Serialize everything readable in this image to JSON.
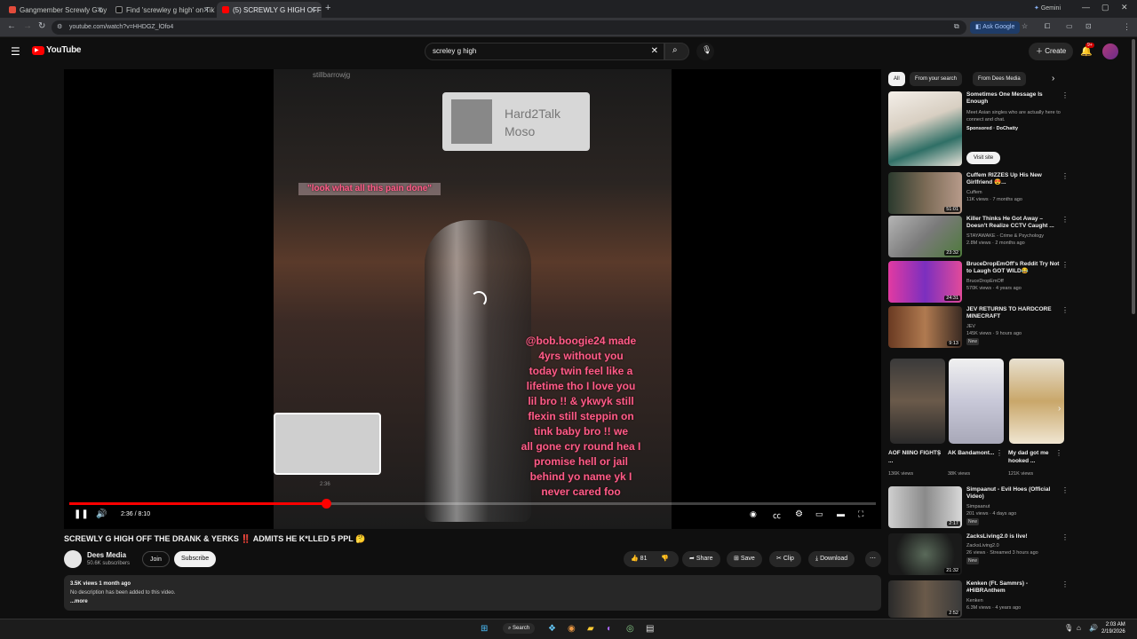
{
  "browser": {
    "tabs": [
      {
        "label": "Gangmember Screwly G by AI",
        "favicon_color": "#e34b3b"
      },
      {
        "label": "Find 'screwley g high' on TikTok",
        "favicon_color": "#111111"
      },
      {
        "label": "(5) SCREWLY G HIGH OFF T",
        "favicon_color": "#ff0000"
      }
    ],
    "new_tab": "+",
    "url": "youtube.com/watch?v=HHDGZ_lOfo4",
    "ask_google": "Ask Google",
    "gemini": "Gemini"
  },
  "header": {
    "logo": "YouTube",
    "search_value": "screley g high",
    "create_label": "Create",
    "notif_count": "9+"
  },
  "player": {
    "overlay_top_handle": "stillbarrowjg",
    "card_name": "Hard2Talk",
    "card_sub": "Moso",
    "caption_top": "\"look what all this pain done\"",
    "caption_main": [
      "@bob.boogie24 made",
      "4yrs without you",
      "today twin feel like a",
      "lifetime tho I love you",
      "lil bro !! & ykwyk still",
      "flexin still steppin on",
      "tink baby bro !! we",
      "all gone cry round hea I",
      "promise hell or jail",
      "behind yo name yk I",
      "never cared foo"
    ],
    "preview_time": "2:36",
    "time": "2:36 / 8:10",
    "progress": 0.318
  },
  "video": {
    "title": "SCREWLY G HIGH OFF THE DRANK & YERKS ‼️ ADMITS HE K*LLED 5 PPL 🤔",
    "channel": "Dees Media",
    "subscribers": "50.6K subscribers",
    "join": "Join",
    "subscribe": "Subscribe",
    "likes": "81",
    "share": "Share",
    "save": "Save",
    "clip": "Clip",
    "download": "Download",
    "views_age": "3.5K views  1 month ago",
    "description": "No description has been added to this video.",
    "more": "...more"
  },
  "sidebar": {
    "chips": [
      "All",
      "From your search",
      "From Dees Media"
    ],
    "ad": {
      "title": "Sometimes One Message Is Enough",
      "desc": "Meet Asian singles who are actually here to connect and chat.",
      "sponsor": "Sponsored · DoChatty",
      "cta": "Visit site"
    },
    "recs": [
      {
        "title": "Cuffem RIZZES Up His New Girlfriend 😍...",
        "channel": "Cuffem",
        "meta": "11K views · 7 months ago",
        "duration": "51:01",
        "new": ""
      },
      {
        "title": "Killer Thinks He Got Away – Doesn't Realize CCTV Caught ...",
        "channel": "STAYAWAKE - Crime & Psychology",
        "meta": "2.8M views · 2 months ago",
        "duration": "23:32",
        "new": ""
      },
      {
        "title": "BruceDropEmOff's Reddit Try Not to Laugh GOT WILD😂",
        "channel": "BruceDropEmOff",
        "meta": "570K views · 4 years ago",
        "duration": "24:31",
        "new": ""
      },
      {
        "title": "JEV RETURNS TO HARDCORE MINECRAFT",
        "channel": "JEV",
        "meta": "145K views · 9 hours ago",
        "duration": "9:13",
        "new": "New"
      }
    ],
    "shorts": [
      {
        "title": "AOF NIINO FIGHTS ...",
        "views": "136K views"
      },
      {
        "title": "AK Bandamont...",
        "views": "38K views"
      },
      {
        "title": "My dad got me hooked ...",
        "views": "121K views"
      }
    ],
    "recs2": [
      {
        "title": "Simpaanut - Evil Hoes (Official Video)",
        "channel": "Simpaanut",
        "meta": "201 views · 4 days ago",
        "duration": "2:17",
        "new": "New"
      },
      {
        "title": "ZacksLiving2.0 is live!",
        "channel": "ZacksLiving2.0",
        "meta": "26 views · Streamed 3 hours ago",
        "duration": "21:32",
        "new": "New"
      },
      {
        "title": "Kenken (Ft. Sammrs) - #HiBRAnthem",
        "channel": "Kenken",
        "meta": "6.3M views · 4 years ago",
        "duration": "2:52",
        "new": ""
      }
    ]
  },
  "taskbar": {
    "search": "Search",
    "time": "2:03 AM",
    "date": "2/19/2026"
  }
}
